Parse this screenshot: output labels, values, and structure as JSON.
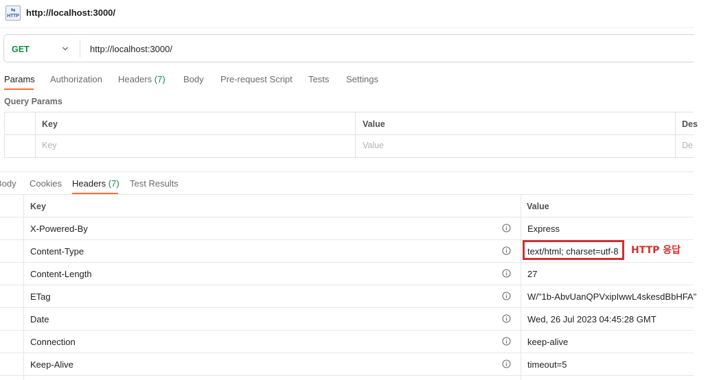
{
  "window": {
    "title": "http://localhost:3000/",
    "icon_label": "HTTP"
  },
  "request": {
    "method": "GET",
    "url": "http://localhost:3000/"
  },
  "request_tabs": [
    {
      "label": "Params",
      "count": ""
    },
    {
      "label": "Authorization",
      "count": ""
    },
    {
      "label": "Headers",
      "count": "(7)"
    },
    {
      "label": "Body",
      "count": ""
    },
    {
      "label": "Pre-request Script",
      "count": ""
    },
    {
      "label": "Tests",
      "count": ""
    },
    {
      "label": "Settings",
      "count": ""
    }
  ],
  "query_params": {
    "title": "Query Params",
    "columns": [
      "Key",
      "Value",
      "Des"
    ],
    "placeholders": [
      "Key",
      "Value",
      "De"
    ]
  },
  "response_tabs": [
    {
      "label": "Body",
      "count": ""
    },
    {
      "label": "Cookies",
      "count": ""
    },
    {
      "label": "Headers",
      "count": "(7)"
    },
    {
      "label": "Test Results",
      "count": ""
    }
  ],
  "response_headers": {
    "columns": [
      "Key",
      "Value"
    ],
    "rows": [
      {
        "key": "X-Powered-By",
        "value": "Express"
      },
      {
        "key": "Content-Type",
        "value": "text/html; charset=utf-8"
      },
      {
        "key": "Content-Length",
        "value": "27"
      },
      {
        "key": "ETag",
        "value": "W/\"1b-AbvUanQPVxipIwwL4skesdBbHFA\""
      },
      {
        "key": "Date",
        "value": "Wed, 26 Jul 2023 04:45:28 GMT"
      },
      {
        "key": "Connection",
        "value": "keep-alive"
      },
      {
        "key": "Keep-Alive",
        "value": "timeout=5"
      }
    ]
  },
  "annotation": {
    "text": "HTTP 응답",
    "color": "#d32f2f"
  },
  "colors": {
    "accent_orange": "#ff6c37",
    "method_green": "#0f8a3e"
  },
  "icons": {
    "title": "http-file-icon",
    "method_dropdown": "chevron-down-icon",
    "header_info": "info-circle-icon"
  }
}
